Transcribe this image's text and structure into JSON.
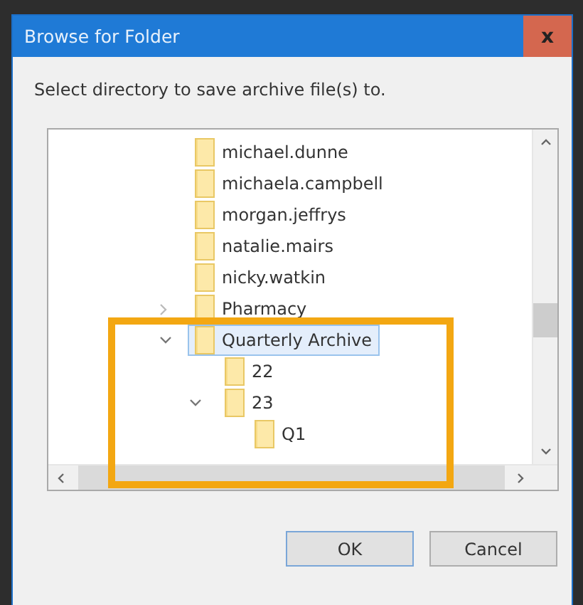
{
  "window": {
    "title": "Browse for Folder",
    "close": "x"
  },
  "instruction": "Select directory to save archive file(s) to.",
  "tree": [
    {
      "label": "michael.dunne",
      "selected": false
    },
    {
      "label": "michaela.campbell",
      "selected": false
    },
    {
      "label": "morgan.jeffrys",
      "selected": false
    },
    {
      "label": "natalie.mairs",
      "selected": false
    },
    {
      "label": "nicky.watkin",
      "selected": false
    },
    {
      "label": "Pharmacy",
      "expanded": false,
      "selected": false
    },
    {
      "label": "Quarterly Archive",
      "expanded": true,
      "selected": true,
      "children": [
        {
          "label": "22",
          "selected": false
        },
        {
          "label": "23",
          "expanded": true,
          "selected": false,
          "children": [
            {
              "label": "Q1",
              "selected": false
            }
          ]
        }
      ]
    }
  ],
  "buttons": [
    {
      "label": "OK",
      "kind": "default"
    },
    {
      "label": "Cancel",
      "kind": "normal"
    }
  ]
}
